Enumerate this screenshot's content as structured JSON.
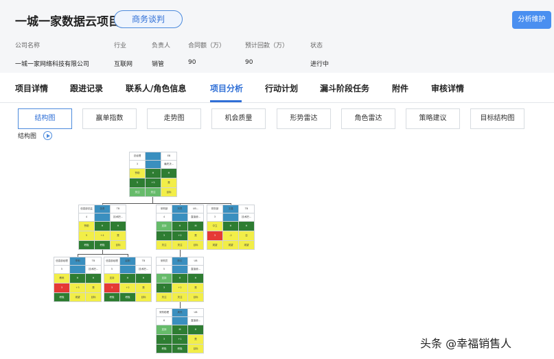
{
  "header": {
    "title": "一城一家数据云项目",
    "stage": "商务谈判",
    "analyze_button": "分析维护",
    "info_labels": [
      "公司名称",
      "行业",
      "负责人",
      "合同额（万）",
      "预计回款（万）",
      "状态"
    ],
    "info_values": [
      "一城一家网络科技有限公司",
      "互联网",
      "销管",
      "90",
      "90",
      "进行中"
    ]
  },
  "tabs": [
    "项目详情",
    "跟进记录",
    "联系人/角色信息",
    "项目分析",
    "行动计划",
    "漏斗阶段任务",
    "附件",
    "审核详情"
  ],
  "active_tab": "项目分析",
  "subtabs": [
    "结构图",
    "赢单指数",
    "走势图",
    "机会质量",
    "形势雷达",
    "角色雷达",
    "策略建议",
    "目标结构图"
  ],
  "active_subtab": "结构图",
  "section_label": "结构图",
  "watermark": "头条 @幸福销售人",
  "colors": {
    "accent": "#2f6fd6",
    "dark_green": "#2e7d32",
    "light_green": "#66bb6a",
    "yellow": "#f2ee48",
    "red": "#e53935",
    "blue_cell": "#3a8fbf"
  }
}
